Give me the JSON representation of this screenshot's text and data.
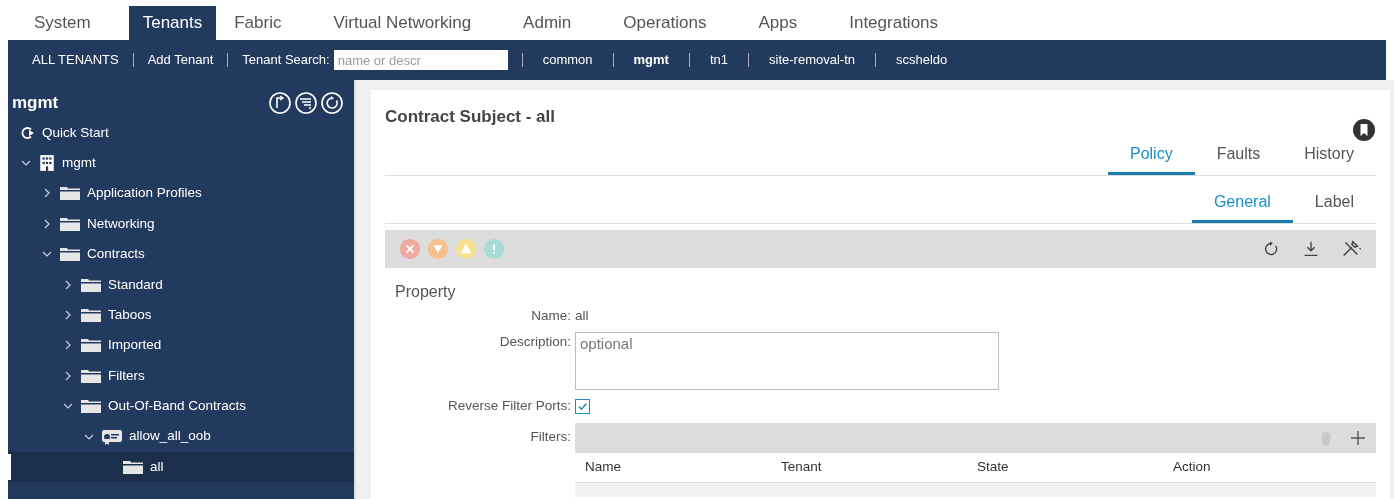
{
  "top_tabs": [
    {
      "label": "System",
      "selected": false
    },
    {
      "label": "Tenants",
      "selected": true
    },
    {
      "label": "Fabric",
      "selected": false
    },
    {
      "label": "Virtual Networking",
      "selected": false
    },
    {
      "label": "Admin",
      "selected": false
    },
    {
      "label": "Operations",
      "selected": false
    },
    {
      "label": "Apps",
      "selected": false
    },
    {
      "label": "Integrations",
      "selected": false
    }
  ],
  "tenant_bar": {
    "links": [
      {
        "label": "ALL TENANTS",
        "selected": false
      },
      {
        "label": "Add Tenant",
        "selected": false
      }
    ],
    "search_label": "Tenant Search:",
    "search_placeholder": "name or descr",
    "tenants": [
      {
        "label": "common",
        "selected": false
      },
      {
        "label": "mgmt",
        "selected": true
      },
      {
        "label": "tn1",
        "selected": false
      },
      {
        "label": "site-removal-tn",
        "selected": false
      },
      {
        "label": "scsheldo",
        "selected": false
      }
    ]
  },
  "sidebar": {
    "title": "mgmt",
    "tree": [
      {
        "label": "Quick Start",
        "kind": "start",
        "selected": false
      },
      {
        "label": "mgmt",
        "kind": "tenant",
        "expanded": true,
        "selected": false,
        "children": [
          {
            "label": "Application Profiles",
            "kind": "folder",
            "expanded": false,
            "selected": false
          },
          {
            "label": "Networking",
            "kind": "folder",
            "expanded": false,
            "selected": false
          },
          {
            "label": "Contracts",
            "kind": "folder",
            "expanded": true,
            "selected": false,
            "children": [
              {
                "label": "Standard",
                "kind": "folder",
                "expanded": false,
                "selected": false
              },
              {
                "label": "Taboos",
                "kind": "folder",
                "expanded": false,
                "selected": false
              },
              {
                "label": "Imported",
                "kind": "folder",
                "expanded": false,
                "selected": false
              },
              {
                "label": "Filters",
                "kind": "folder",
                "expanded": false,
                "selected": false
              },
              {
                "label": "Out-Of-Band Contracts",
                "kind": "folder",
                "expanded": true,
                "selected": false,
                "children": [
                  {
                    "label": "allow_all_oob",
                    "kind": "contract",
                    "expanded": true,
                    "selected": false,
                    "children": [
                      {
                        "label": "all",
                        "kind": "leaf",
                        "selected": true
                      }
                    ]
                  }
                ]
              }
            ]
          }
        ]
      }
    ]
  },
  "panel": {
    "title": "Contract Subject - all",
    "tabs": [
      {
        "label": "Policy",
        "selected": true
      },
      {
        "label": "Faults",
        "selected": false
      },
      {
        "label": "History",
        "selected": false
      }
    ],
    "subtabs": [
      {
        "label": "General",
        "selected": true
      },
      {
        "label": "Label",
        "selected": false
      }
    ],
    "section": "Property",
    "fields": [
      {
        "kind": "text",
        "label": "Name:",
        "value": "all"
      },
      {
        "kind": "textarea",
        "label": "Description:",
        "placeholder": "optional"
      },
      {
        "kind": "checkbox",
        "label": "Reverse Filter Ports:",
        "checked": true
      }
    ],
    "filters": {
      "label": "Filters:",
      "columns": [
        "Name",
        "Tenant",
        "State",
        "Action"
      ]
    }
  }
}
